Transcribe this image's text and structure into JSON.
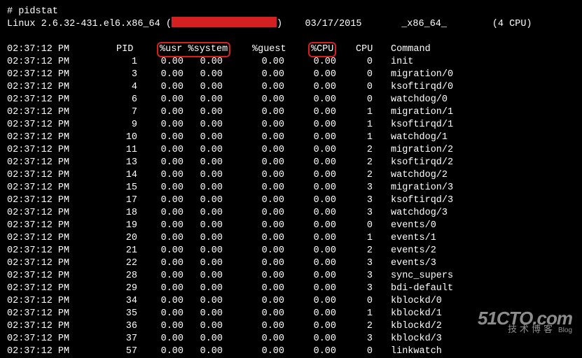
{
  "prompt": "# pidstat",
  "sysline": {
    "prefix": "Linux 2.6.32-431.el6.x86_64 (",
    "suffix": ")",
    "date": "03/17/2015",
    "arch": "_x86_64_",
    "cpus": "(4 CPU)"
  },
  "headers": {
    "time": "02:37:12 PM",
    "pid": "PID",
    "usr_sys": "%usr %system",
    "guest": "%guest",
    "cpu_pct": "%CPU",
    "ncpu": "CPU",
    "cmd": "Command"
  },
  "rows": [
    {
      "time": "02:37:12 PM",
      "pid": "1",
      "usr": "0.00",
      "sys": "0.00",
      "gst": "0.00",
      "cpu": "0.00",
      "ncp": "0",
      "cmd": "init"
    },
    {
      "time": "02:37:12 PM",
      "pid": "3",
      "usr": "0.00",
      "sys": "0.00",
      "gst": "0.00",
      "cpu": "0.00",
      "ncp": "0",
      "cmd": "migration/0"
    },
    {
      "time": "02:37:12 PM",
      "pid": "4",
      "usr": "0.00",
      "sys": "0.00",
      "gst": "0.00",
      "cpu": "0.00",
      "ncp": "0",
      "cmd": "ksoftirqd/0"
    },
    {
      "time": "02:37:12 PM",
      "pid": "6",
      "usr": "0.00",
      "sys": "0.00",
      "gst": "0.00",
      "cpu": "0.00",
      "ncp": "0",
      "cmd": "watchdog/0"
    },
    {
      "time": "02:37:12 PM",
      "pid": "7",
      "usr": "0.00",
      "sys": "0.00",
      "gst": "0.00",
      "cpu": "0.00",
      "ncp": "1",
      "cmd": "migration/1"
    },
    {
      "time": "02:37:12 PM",
      "pid": "9",
      "usr": "0.00",
      "sys": "0.00",
      "gst": "0.00",
      "cpu": "0.00",
      "ncp": "1",
      "cmd": "ksoftirqd/1"
    },
    {
      "time": "02:37:12 PM",
      "pid": "10",
      "usr": "0.00",
      "sys": "0.00",
      "gst": "0.00",
      "cpu": "0.00",
      "ncp": "1",
      "cmd": "watchdog/1"
    },
    {
      "time": "02:37:12 PM",
      "pid": "11",
      "usr": "0.00",
      "sys": "0.00",
      "gst": "0.00",
      "cpu": "0.00",
      "ncp": "2",
      "cmd": "migration/2"
    },
    {
      "time": "02:37:12 PM",
      "pid": "13",
      "usr": "0.00",
      "sys": "0.00",
      "gst": "0.00",
      "cpu": "0.00",
      "ncp": "2",
      "cmd": "ksoftirqd/2"
    },
    {
      "time": "02:37:12 PM",
      "pid": "14",
      "usr": "0.00",
      "sys": "0.00",
      "gst": "0.00",
      "cpu": "0.00",
      "ncp": "2",
      "cmd": "watchdog/2"
    },
    {
      "time": "02:37:12 PM",
      "pid": "15",
      "usr": "0.00",
      "sys": "0.00",
      "gst": "0.00",
      "cpu": "0.00",
      "ncp": "3",
      "cmd": "migration/3"
    },
    {
      "time": "02:37:12 PM",
      "pid": "17",
      "usr": "0.00",
      "sys": "0.00",
      "gst": "0.00",
      "cpu": "0.00",
      "ncp": "3",
      "cmd": "ksoftirqd/3"
    },
    {
      "time": "02:37:12 PM",
      "pid": "18",
      "usr": "0.00",
      "sys": "0.00",
      "gst": "0.00",
      "cpu": "0.00",
      "ncp": "3",
      "cmd": "watchdog/3"
    },
    {
      "time": "02:37:12 PM",
      "pid": "19",
      "usr": "0.00",
      "sys": "0.00",
      "gst": "0.00",
      "cpu": "0.00",
      "ncp": "0",
      "cmd": "events/0"
    },
    {
      "time": "02:37:12 PM",
      "pid": "20",
      "usr": "0.00",
      "sys": "0.00",
      "gst": "0.00",
      "cpu": "0.00",
      "ncp": "1",
      "cmd": "events/1"
    },
    {
      "time": "02:37:12 PM",
      "pid": "21",
      "usr": "0.00",
      "sys": "0.00",
      "gst": "0.00",
      "cpu": "0.00",
      "ncp": "2",
      "cmd": "events/2"
    },
    {
      "time": "02:37:12 PM",
      "pid": "22",
      "usr": "0.00",
      "sys": "0.00",
      "gst": "0.00",
      "cpu": "0.00",
      "ncp": "3",
      "cmd": "events/3"
    },
    {
      "time": "02:37:12 PM",
      "pid": "28",
      "usr": "0.00",
      "sys": "0.00",
      "gst": "0.00",
      "cpu": "0.00",
      "ncp": "3",
      "cmd": "sync_supers"
    },
    {
      "time": "02:37:12 PM",
      "pid": "29",
      "usr": "0.00",
      "sys": "0.00",
      "gst": "0.00",
      "cpu": "0.00",
      "ncp": "3",
      "cmd": "bdi-default"
    },
    {
      "time": "02:37:12 PM",
      "pid": "34",
      "usr": "0.00",
      "sys": "0.00",
      "gst": "0.00",
      "cpu": "0.00",
      "ncp": "0",
      "cmd": "kblockd/0"
    },
    {
      "time": "02:37:12 PM",
      "pid": "35",
      "usr": "0.00",
      "sys": "0.00",
      "gst": "0.00",
      "cpu": "0.00",
      "ncp": "1",
      "cmd": "kblockd/1"
    },
    {
      "time": "02:37:12 PM",
      "pid": "36",
      "usr": "0.00",
      "sys": "0.00",
      "gst": "0.00",
      "cpu": "0.00",
      "ncp": "2",
      "cmd": "kblockd/2"
    },
    {
      "time": "02:37:12 PM",
      "pid": "37",
      "usr": "0.00",
      "sys": "0.00",
      "gst": "0.00",
      "cpu": "0.00",
      "ncp": "3",
      "cmd": "kblockd/3"
    },
    {
      "time": "02:37:12 PM",
      "pid": "57",
      "usr": "0.00",
      "sys": "0.00",
      "gst": "0.00",
      "cpu": "0.00",
      "ncp": "0",
      "cmd": "linkwatch"
    }
  ],
  "watermark": {
    "big": "51CTO.com",
    "small": "技术博客",
    "blog": "Blog"
  }
}
